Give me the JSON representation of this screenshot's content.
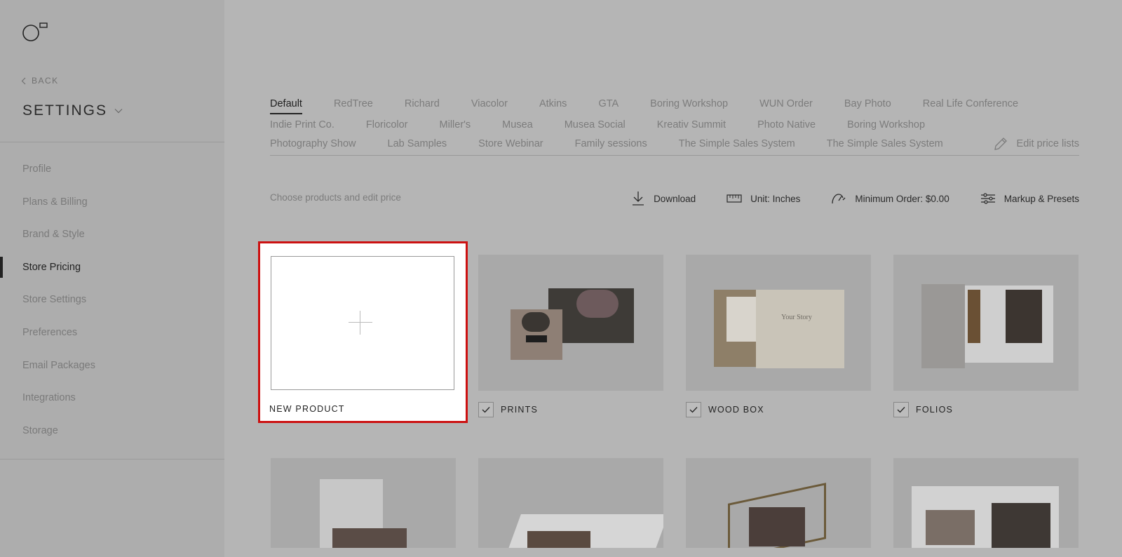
{
  "sidebar": {
    "back_label": "BACK",
    "title": "SETTINGS",
    "items": [
      {
        "label": "Profile"
      },
      {
        "label": "Plans & Billing"
      },
      {
        "label": "Brand & Style"
      },
      {
        "label": "Store Pricing"
      },
      {
        "label": "Store Settings"
      },
      {
        "label": "Preferences"
      },
      {
        "label": "Email Packages"
      },
      {
        "label": "Integrations"
      },
      {
        "label": "Storage"
      }
    ],
    "active_item": "Store Pricing"
  },
  "tabs": {
    "row1": [
      "Default",
      "RedTree",
      "Richard",
      "Viacolor",
      "Atkins",
      "GTA",
      "Boring Workshop",
      "WUN Order",
      "Bay Photo",
      "Real Life Conference"
    ],
    "row2": [
      "Indie Print Co.",
      "Floricolor",
      "Miller's",
      "Musea",
      "Musea Social",
      "Kreativ Summit",
      "Photo Native",
      "Boring Workshop"
    ],
    "row3": [
      "Photography Show",
      "Lab Samples",
      "Store Webinar",
      "Family sessions",
      "The Simple Sales System",
      "The Simple Sales System"
    ],
    "active": "Default",
    "edit_label": "Edit price lists"
  },
  "toolbar": {
    "subtitle": "Choose products and edit price",
    "download": "Download",
    "unit": "Unit: Inches",
    "minimum_order": "Minimum Order: $0.00",
    "markup": "Markup & Presets"
  },
  "products": {
    "new_product": "NEW PRODUCT",
    "items": [
      {
        "label": "PRINTS",
        "checked": true
      },
      {
        "label": "WOOD BOX",
        "checked": true
      },
      {
        "label": "FOLIOS",
        "checked": true
      }
    ],
    "wood_box_text": "Your Story"
  },
  "colors": {
    "highlight": "#cc1111",
    "overlay_bg": "#b5b5b5",
    "sidebar_bg": "#adadad"
  }
}
